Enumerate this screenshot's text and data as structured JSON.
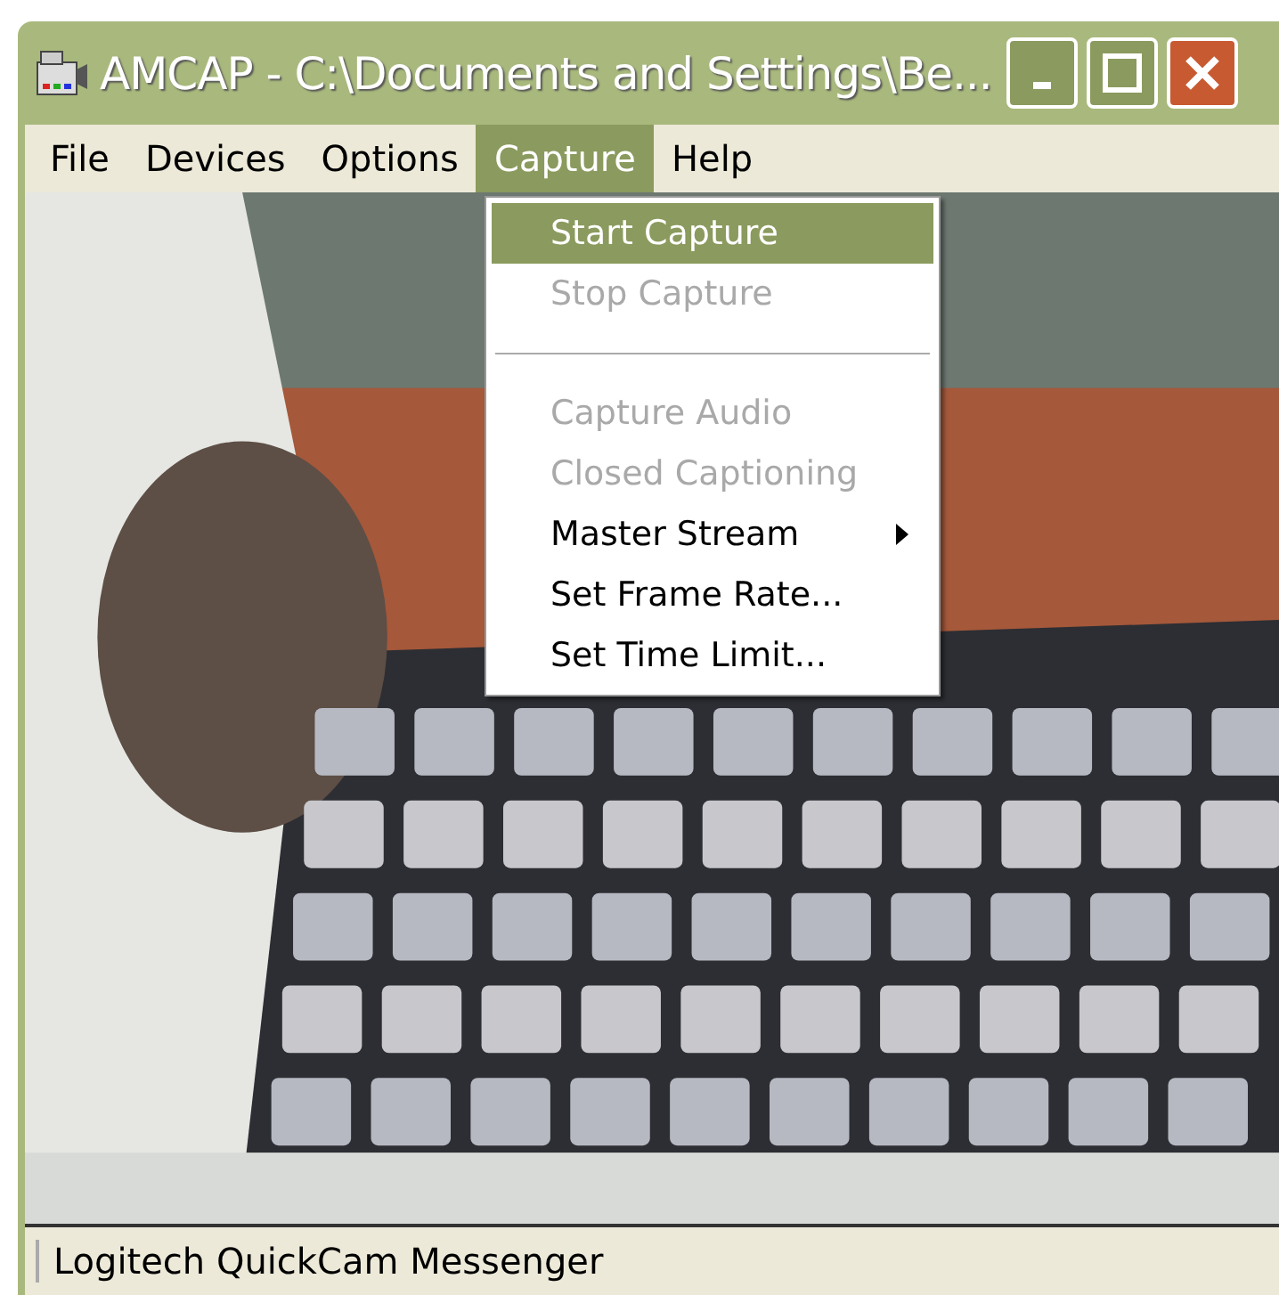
{
  "window": {
    "title": "AMCAP - C:\\Documents and Settings\\Be..."
  },
  "title_buttons": [
    {
      "kind": "minimize"
    },
    {
      "kind": "maximize"
    },
    {
      "kind": "close"
    }
  ],
  "menu_bar": [
    {
      "label": "File",
      "selected": false
    },
    {
      "label": "Devices",
      "selected": false
    },
    {
      "label": "Options",
      "selected": false
    },
    {
      "label": "Capture",
      "selected": true
    },
    {
      "label": "Help",
      "selected": false
    }
  ],
  "dropdown": [
    {
      "kind": "item",
      "label": "Start Capture",
      "selected": true,
      "disabled": false
    },
    {
      "kind": "item",
      "label": "Stop Capture",
      "selected": false,
      "disabled": true
    },
    {
      "kind": "separator"
    },
    {
      "kind": "item",
      "label": "Capture Audio",
      "selected": false,
      "disabled": true
    },
    {
      "kind": "item",
      "label": "Closed Captioning",
      "selected": false,
      "disabled": true
    },
    {
      "kind": "submenu",
      "label": "Master Stream",
      "selected": false,
      "disabled": false
    },
    {
      "kind": "item",
      "label": "Set Frame Rate...",
      "selected": false,
      "disabled": false
    },
    {
      "kind": "item",
      "label": "Set Time Limit...",
      "selected": false,
      "disabled": false
    }
  ],
  "status_bar": "Logitech QuickCam Messenger"
}
